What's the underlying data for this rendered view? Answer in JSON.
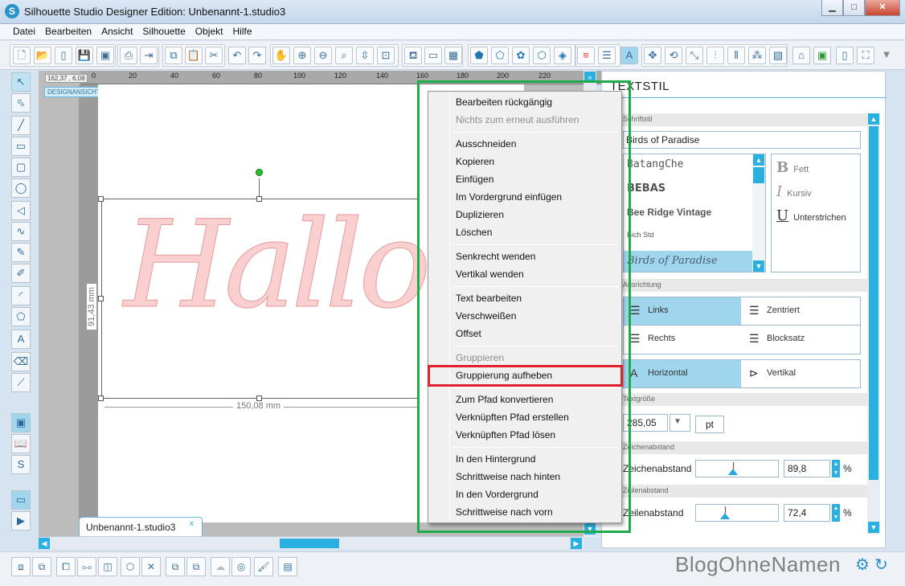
{
  "window": {
    "title": "Silhouette Studio Designer Edition: Unbenannt-1.studio3",
    "logo_letter": "S",
    "minimize": "▁",
    "maximize": "□",
    "close": "✕"
  },
  "menubar": [
    "Datei",
    "Bearbeiten",
    "Ansicht",
    "Silhouette",
    "Objekt",
    "Hilfe"
  ],
  "canvas": {
    "coord_readout": "162,37 , 6,08",
    "design_label": "DESIGNANSICHT",
    "ruler_ticks": [
      "0",
      "20",
      "40",
      "60",
      "80",
      "100",
      "120",
      "140",
      "160",
      "180",
      "200",
      "220"
    ],
    "text_object": "Hallo",
    "width_dim": "150,08 mm",
    "height_dim": "91,43 mm",
    "doc_tab": "Unbenannt-1.studio3",
    "doc_tab_close": "x",
    "expand_icon": "»"
  },
  "context_menu": {
    "items": [
      {
        "label": "Bearbeiten rückgängig",
        "disabled": false
      },
      {
        "label": "Nichts zum erneut ausführen",
        "disabled": true
      },
      {
        "label": "Ausschneiden",
        "disabled": false
      },
      {
        "label": "Kopieren",
        "disabled": false
      },
      {
        "label": "Einfügen",
        "disabled": false
      },
      {
        "label": "Im Vordergrund einfügen",
        "disabled": false
      },
      {
        "label": "Duplizieren",
        "disabled": false
      },
      {
        "label": "Löschen",
        "disabled": false
      },
      {
        "label": "Senkrecht wenden",
        "disabled": false
      },
      {
        "label": "Vertikal wenden",
        "disabled": false
      },
      {
        "label": "Text bearbeiten",
        "disabled": false
      },
      {
        "label": "Verschweißen",
        "disabled": false
      },
      {
        "label": "Offset",
        "disabled": false
      },
      {
        "label": "Gruppieren",
        "disabled": true
      },
      {
        "label": "Gruppierung aufheben",
        "disabled": false,
        "highlighted": true
      },
      {
        "label": "Zum Pfad konvertieren",
        "disabled": false
      },
      {
        "label": "Verknüpften Pfad erstellen",
        "disabled": false
      },
      {
        "label": "Verknüpften Pfad lösen",
        "disabled": false
      },
      {
        "label": "In den Hintergrund",
        "disabled": false
      },
      {
        "label": "Schrittweise nach hinten",
        "disabled": false
      },
      {
        "label": "In den Vordergrund",
        "disabled": false
      },
      {
        "label": "Schrittweise nach vorn",
        "disabled": false
      }
    ]
  },
  "text_panel": {
    "title": "TEXTSTIL",
    "font_section": "Schriftstil",
    "font_value": "Birds of Paradise",
    "fonts": [
      "BatangChe",
      "BEBAS",
      "Bee Ridge Vintage",
      "Bich Std",
      "Birds of Paradise"
    ],
    "bold_label": "Fett",
    "italic_label": "Kursiv",
    "underline_label": "Unterstrichen",
    "bold_glyph": "B",
    "italic_glyph": "I",
    "underline_glyph": "U",
    "align_section": "Ausrichtung",
    "align_left": "Links",
    "align_center": "Zentriert",
    "align_right": "Rechts",
    "align_block": "Blocksatz",
    "horizontal": "Horizontal",
    "vertical": "Vertikal",
    "size_section": "Textgröße",
    "size_value": "285,05",
    "size_unit": "pt",
    "char_section": "Zeichenabstand",
    "char_label": "Zeichenabstand",
    "char_value": "89,8",
    "char_unit": "%",
    "line_section": "Zeilenabstand",
    "line_label": "Zeilenabstand",
    "line_value": "72,4",
    "line_unit": "%"
  },
  "branding": {
    "text": "BlogOhneNamen"
  },
  "colors": {
    "accent": "#2ab0e0",
    "green_frame": "#1faa4b",
    "red_frame": "#e0202a",
    "text_fill": "#f9cfcf"
  }
}
